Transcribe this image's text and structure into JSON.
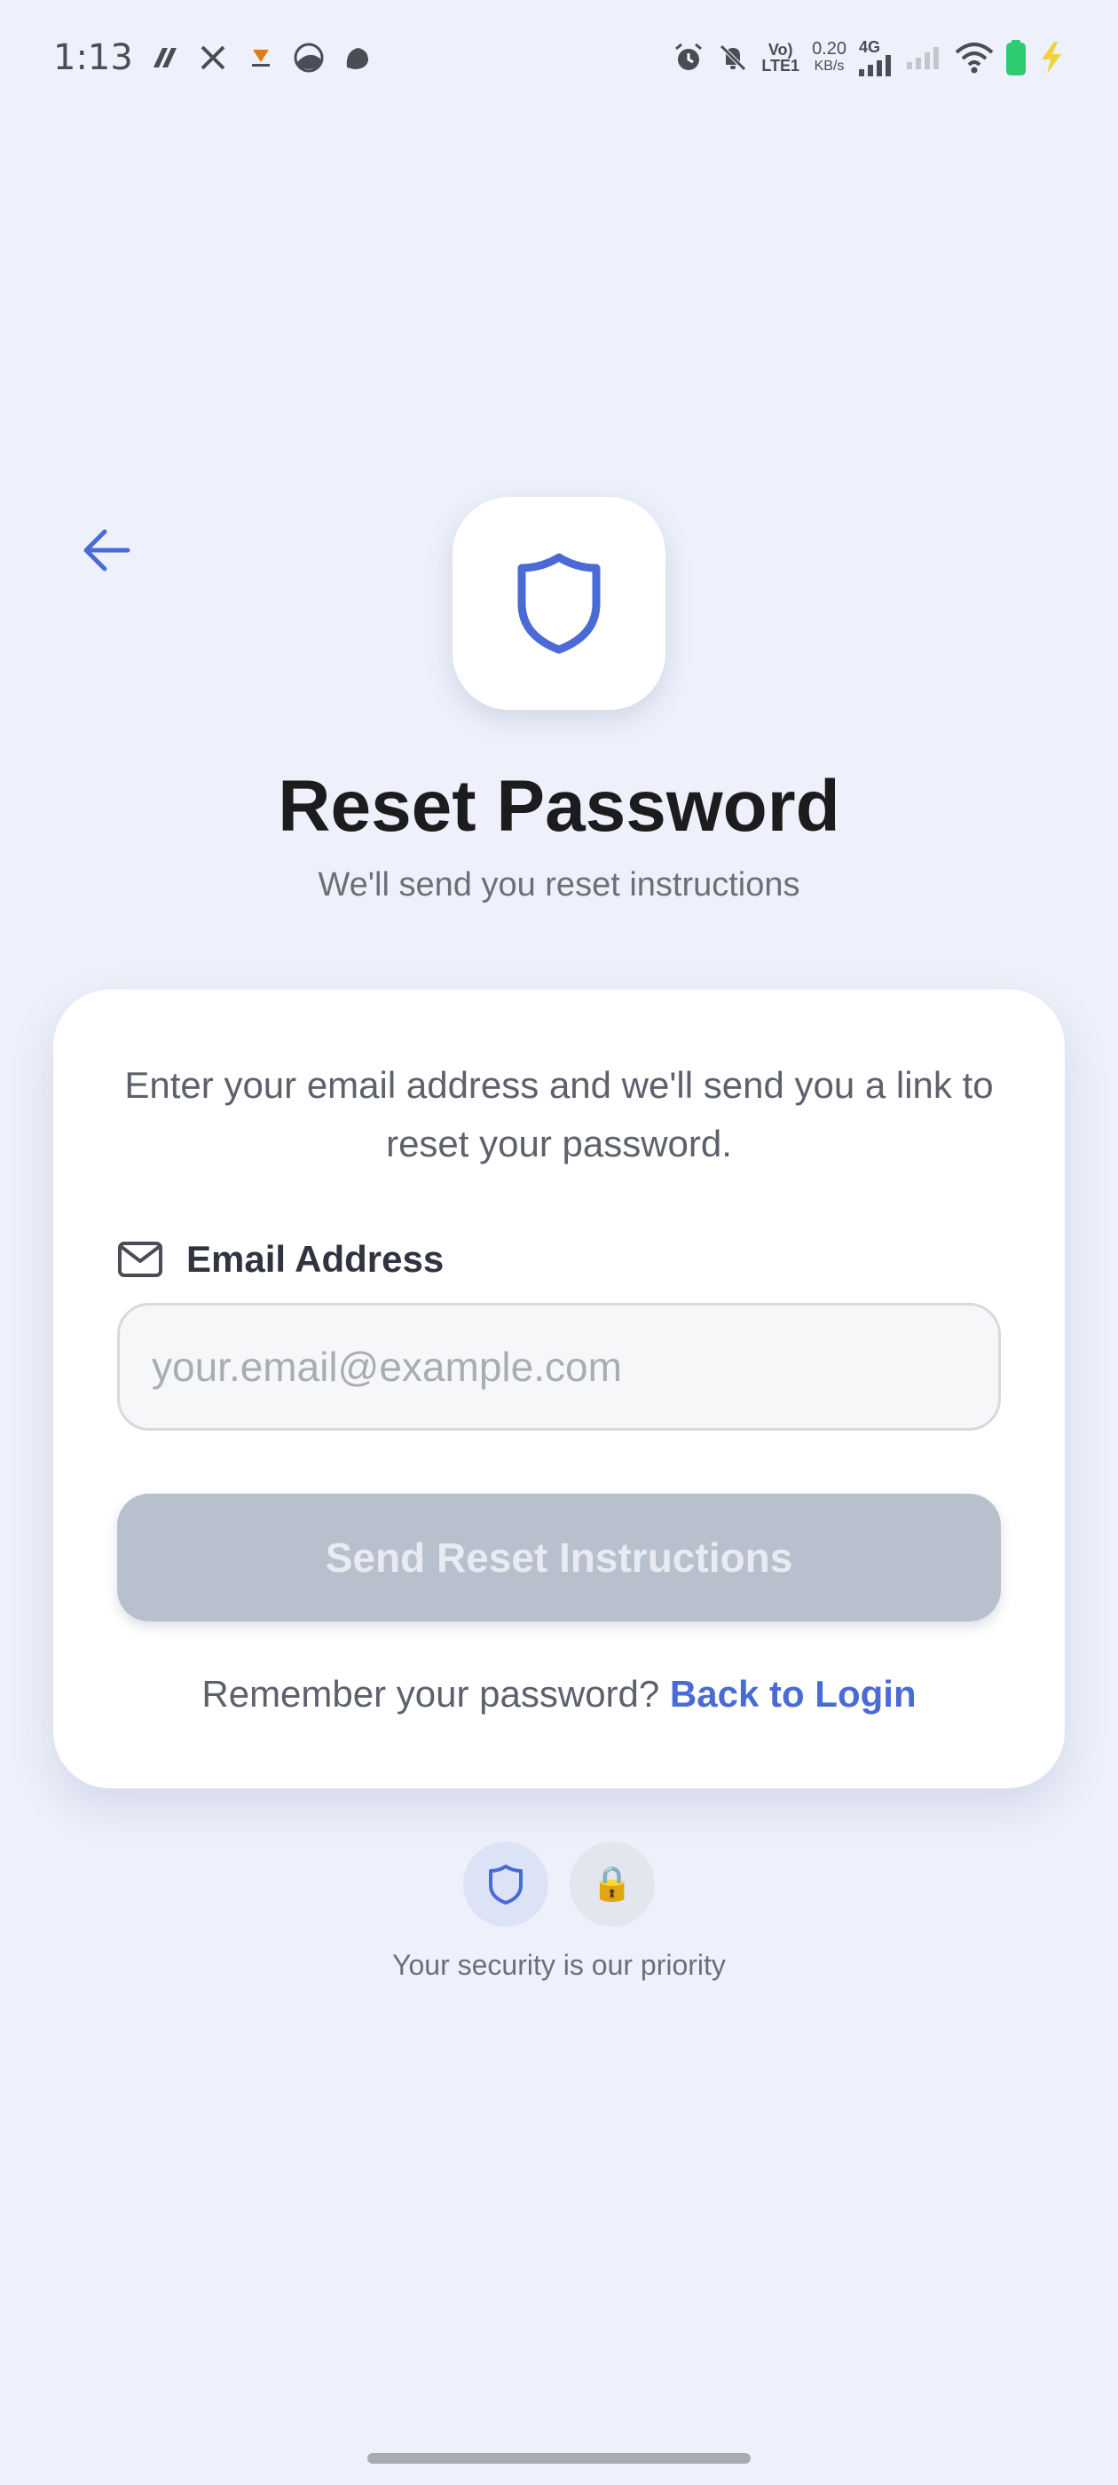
{
  "status_bar": {
    "time": "1:13",
    "volte_line1": "Vo)",
    "volte_line2": "LTE1",
    "net_speed_value": "0.20",
    "net_speed_unit": "KB/s",
    "network_type": "4G",
    "icons": [
      "app-icon",
      "x-icon",
      "app-icon",
      "app-icon",
      "app-icon",
      "alarm-icon",
      "mute-icon",
      "signal-icon",
      "wifi-icon",
      "battery-icon",
      "charging-icon"
    ]
  },
  "header": {
    "back_icon": "arrow-left-icon",
    "logo_icon": "shield-icon"
  },
  "title": "Reset Password",
  "subtitle": "We'll send you reset instructions",
  "card": {
    "description": "Enter your email address and we'll send you a link to reset your password.",
    "email_label": "Email Address",
    "email_icon": "mail-icon",
    "email_value": "",
    "email_placeholder": "your.email@example.com",
    "submit_label": "Send Reset Instructions",
    "login_prompt": "Remember your password?",
    "login_link": "Back to Login"
  },
  "footer": {
    "badge_icons": [
      "shield-icon",
      "lock-icon"
    ],
    "lock_glyph": "🔒",
    "text": "Your security is our priority"
  },
  "colors": {
    "background": "#eef1fb",
    "accent": "#4a6bd6",
    "button_disabled": "#b9c0cd",
    "text_primary": "#1c1c1e",
    "text_secondary": "#6b6f78"
  }
}
